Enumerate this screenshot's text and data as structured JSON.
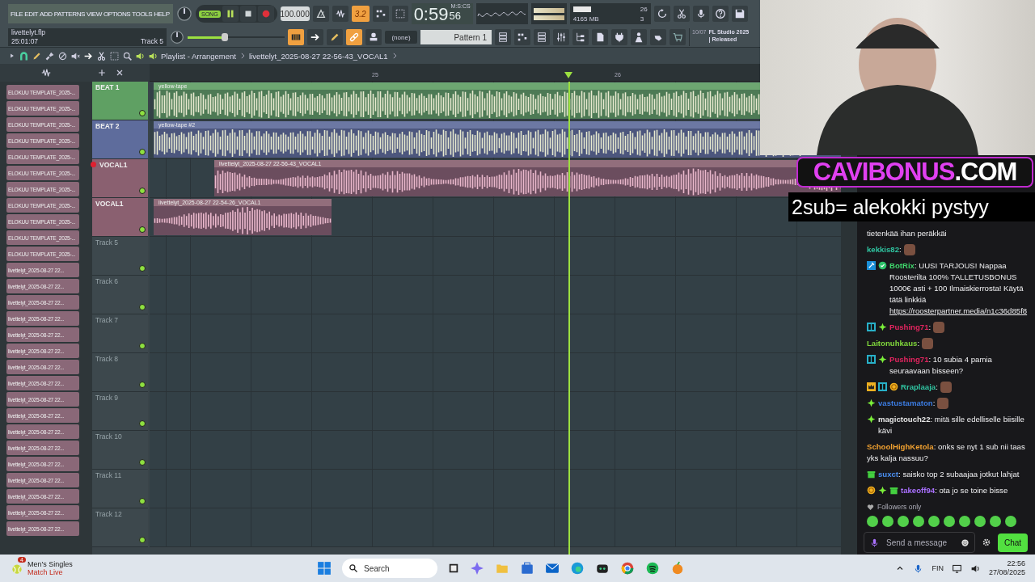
{
  "menu": [
    "FILE",
    "EDIT",
    "ADD",
    "PATTERNS",
    "VIEW",
    "OPTIONS",
    "TOOLS",
    "HELP"
  ],
  "transport": {
    "mode": "SONG",
    "mode_selected": true,
    "playing": true,
    "tempo": "100.000",
    "step_label": "3.2",
    "step_selected": true
  },
  "time": {
    "main": "0:59",
    "small": "56",
    "unit": "M:S:CS"
  },
  "project": {
    "file": "livettelyt.flp",
    "position": "25:01:07",
    "hint": "Track 5"
  },
  "master_volume": {
    "level": 0.38
  },
  "performance": {
    "cpu": "26",
    "memory": "4165 MB",
    "polyphony": "3"
  },
  "snap_tools": [
    {
      "selected": true
    },
    {
      "selected": false
    },
    {
      "selected": false
    },
    {
      "selected": true
    },
    {
      "selected": false
    }
  ],
  "channel": "(none)",
  "pattern": "Pattern 1",
  "news": {
    "date": "10/07",
    "text": "FL Studio 2025 | Released"
  },
  "playlist": {
    "title": "Playlist - Arrangement",
    "clip": "livettelyt_2025-08-27 22-56-43_VOCAL1",
    "ruler": [
      "25",
      "26"
    ]
  },
  "picker": [
    "ELOKUU TEMPLATE_2025-...",
    "ELOKUU TEMPLATE_2025-...",
    "ELOKUU TEMPLATE_2025-...",
    "ELOKUU TEMPLATE_2025-...",
    "ELOKUU TEMPLATE_2025-...",
    "ELOKUU TEMPLATE_2025-...",
    "ELOKUU TEMPLATE_2025-...",
    "ELOKUU TEMPLATE_2025-...",
    "ELOKUU TEMPLATE_2025-...",
    "ELOKUU TEMPLATE_2025-...",
    "ELOKUU TEMPLATE_2025-...",
    "livettelyt_2025-08-27 22...",
    "livettelyt_2025-08-27 22...",
    "livettelyt_2025-08-27 22...",
    "livettelyt_2025-08-27 22...",
    "livettelyt_2025-08-27 22...",
    "livettelyt_2025-08-27 22...",
    "livettelyt_2025-08-27 22...",
    "livettelyt_2025-08-27 22...",
    "livettelyt_2025-08-27 22...",
    "livettelyt_2025-08-27 22...",
    "livettelyt_2025-08-27 22...",
    "livettelyt_2025-08-27 22...",
    "livettelyt_2025-08-27 22...",
    "livettelyt_2025-08-27 22...",
    "livettelyt_2025-08-27 22...",
    "livettelyt_2025-08-27 22...",
    "livettelyt_2025-08-27 22..."
  ],
  "tracks": [
    {
      "name": "BEAT 1",
      "color": "#5fa063",
      "armed": false,
      "enabled": true,
      "clips": [
        {
          "label": "yellow-tape",
          "kind": "beat"
        }
      ]
    },
    {
      "name": "BEAT 2",
      "color": "#5e6c9c",
      "armed": false,
      "enabled": true,
      "clips": [
        {
          "label": "yellow-tape #2",
          "kind": "beat"
        }
      ]
    },
    {
      "name": "VOCAL1",
      "color": "#8a6070",
      "armed": true,
      "enabled": true,
      "clips": [
        {
          "label": "livettelyt_2025-08-27 22-56-43_VOCAL1",
          "kind": "vocal"
        }
      ]
    },
    {
      "name": "VOCAL1",
      "color": "#8a6070",
      "armed": false,
      "enabled": true,
      "clips": [
        {
          "label": "livettelyt_2025-08-27 22-54-26_VOCAL1",
          "kind": "vocal"
        }
      ]
    },
    {
      "name": "Track 5",
      "armed": false,
      "enabled": true
    },
    {
      "name": "Track 6",
      "armed": false,
      "enabled": true
    },
    {
      "name": "Track 7",
      "armed": false,
      "enabled": true
    },
    {
      "name": "Track 8",
      "armed": false,
      "enabled": true
    },
    {
      "name": "Track 9",
      "armed": false,
      "enabled": true
    },
    {
      "name": "Track 10",
      "armed": false,
      "enabled": true
    },
    {
      "name": "Track 11",
      "armed": false,
      "enabled": true
    },
    {
      "name": "Track 12",
      "armed": false,
      "enabled": true
    }
  ],
  "overlay": {
    "brand": "CAVIBONUS",
    "suffix": ".COM",
    "ticker": "2sub= alekokki pystyy"
  },
  "chat": {
    "messages": [
      {
        "text": "tietenkää ihan peräkkäi",
        "emote": false
      },
      {
        "user": "kekkis82",
        "color": "#2fc3a0",
        "text": ":",
        "emote": true
      },
      {
        "user": "BotRix",
        "color": "#3fd46b",
        "badges": [
          {
            "kind": "mod"
          },
          {
            "kind": "verified"
          }
        ],
        "text": ": UUSI TARJOUS! Nappaa Roosterilta 100% TALLETUSBONUS 1000€ asti + 100 Ilmaiskierrosta! Käytä tätä linkkiä",
        "link": "https://roosterpartner.media/n1c36d85f8",
        "emote": false
      },
      {
        "user": "Pushing71",
        "color": "#e0245e",
        "badges": [
          {
            "kind": "sub"
          },
          {
            "kind": "sparkle"
          }
        ],
        "text": ":",
        "emote": true
      },
      {
        "user": "Laitonuhkaus",
        "color": "#7fd63b",
        "text": ":",
        "emote": true
      },
      {
        "user": "Pushing71",
        "color": "#e0245e",
        "badges": [
          {
            "kind": "sub"
          },
          {
            "kind": "sparkle"
          }
        ],
        "text": ": 10 subia 4 pamia seuraavaan bisseen?",
        "emote": false
      },
      {
        "user": "Rraplaaja",
        "color": "#2fc3a0",
        "badges": [
          {
            "kind": "crown"
          },
          {
            "kind": "sub"
          },
          {
            "kind": "coin"
          }
        ],
        "text": ":",
        "emote": true
      },
      {
        "user": "vastustamaton",
        "color": "#3b7be0",
        "badges": [
          {
            "kind": "sparkle"
          }
        ],
        "text": ":",
        "emote": true
      },
      {
        "user": "magictouch22",
        "color": "#e6e6e6",
        "badges": [
          {
            "kind": "sparkle"
          }
        ],
        "text": ": mitä sille edelliselle biisille kävi",
        "emote": false
      },
      {
        "user": "SchoolHighKetola",
        "color": "#f0a030",
        "text": ": onks se nyt 1 sub nii taas yks kalja nassuu?",
        "emote": false
      },
      {
        "user": "suxct",
        "color": "#4a8ef0",
        "badges": [
          {
            "kind": "gift"
          }
        ],
        "text": ": saisko top 2 subaajaa jotkut lahjat",
        "emote": false
      },
      {
        "user": "takeoff94",
        "color": "#a970ff",
        "badges": [
          {
            "kind": "coin"
          },
          {
            "kind": "sparkle"
          },
          {
            "kind": "gift"
          }
        ],
        "text": ": ota jo se toine bisse",
        "emote": false
      }
    ],
    "mode": "Followers only",
    "placeholder": "Send a message",
    "send": "Chat"
  },
  "taskbar": {
    "notification_count": "4",
    "notification_title": "Men's Singles",
    "notification_text": "Match Live",
    "search_placeholder": "Search",
    "language": "FIN",
    "time": "22:56",
    "date": "27/08/2025"
  }
}
